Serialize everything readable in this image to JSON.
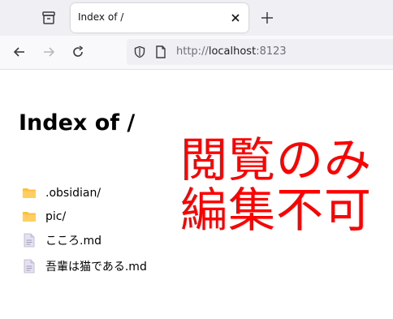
{
  "browser": {
    "tab": {
      "title": "Index of /"
    },
    "address_bar": {
      "scheme": "http://",
      "host": "localhost",
      "port": ":8123"
    }
  },
  "page": {
    "title": "Index of /",
    "entries": [
      {
        "name": ".obsidian/",
        "icon": "folder-icon"
      },
      {
        "name": "pic/",
        "icon": "folder-icon"
      },
      {
        "name": "こころ.md",
        "icon": "file-icon"
      },
      {
        "name": "吾輩は猫である.md",
        "icon": "file-icon"
      }
    ],
    "overlay": {
      "line1": "閲覧のみ",
      "line2": "編集不可",
      "color": "#ff0000"
    }
  },
  "colors": {
    "folder": "#ffbf3f",
    "file": "#e6e1f2"
  }
}
